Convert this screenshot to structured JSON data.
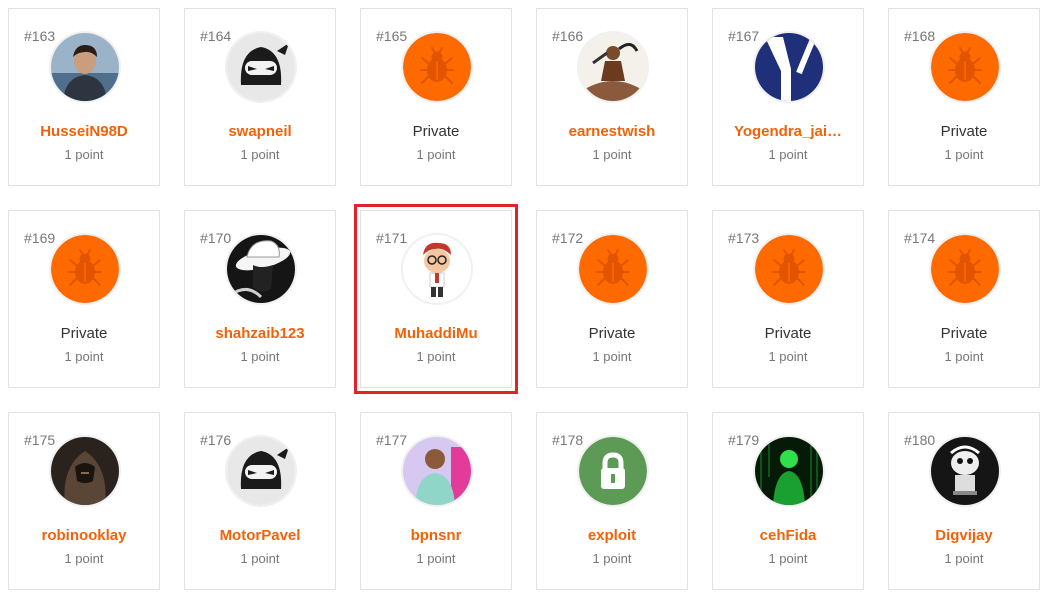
{
  "colors": {
    "accent": "#f0630a",
    "private_avatar": "#ff6a00",
    "highlight": "#e1222a"
  },
  "users": [
    {
      "rank": "#163",
      "name": "HusseiN98D",
      "points": "1 point",
      "avatar": "photo-person-icon",
      "private": false
    },
    {
      "rank": "#164",
      "name": "swapneil",
      "points": "1 point",
      "avatar": "ninja-icon",
      "private": false
    },
    {
      "rank": "#165",
      "name": "Private",
      "points": "1 point",
      "avatar": "bug-icon",
      "private": true
    },
    {
      "rank": "#166",
      "name": "earnestwish",
      "points": "1 point",
      "avatar": "warrior-photo-icon",
      "private": false
    },
    {
      "rank": "#167",
      "name": "Yogendra_jai…",
      "points": "1 point",
      "avatar": "y-logo-icon",
      "private": false
    },
    {
      "rank": "#168",
      "name": "Private",
      "points": "1 point",
      "avatar": "bug-icon",
      "private": true
    },
    {
      "rank": "#169",
      "name": "Private",
      "points": "1 point",
      "avatar": "bug-icon",
      "private": true
    },
    {
      "rank": "#170",
      "name": "shahzaib123",
      "points": "1 point",
      "avatar": "hat-man-icon",
      "private": false
    },
    {
      "rank": "#171",
      "name": "MuhaddiMu",
      "points": "1 point",
      "avatar": "cartoon-boy-icon",
      "private": false,
      "highlight": true
    },
    {
      "rank": "#172",
      "name": "Private",
      "points": "1 point",
      "avatar": "bug-icon",
      "private": true
    },
    {
      "rank": "#173",
      "name": "Private",
      "points": "1 point",
      "avatar": "bug-icon",
      "private": true
    },
    {
      "rank": "#174",
      "name": "Private",
      "points": "1 point",
      "avatar": "bug-icon",
      "private": true
    },
    {
      "rank": "#175",
      "name": "robinooklay",
      "points": "1 point",
      "avatar": "assassin-photo-icon",
      "private": false
    },
    {
      "rank": "#176",
      "name": "MotorPavel",
      "points": "1 point",
      "avatar": "ninja-icon",
      "private": false
    },
    {
      "rank": "#177",
      "name": "bpnsnr",
      "points": "1 point",
      "avatar": "colorful-person-icon",
      "private": false
    },
    {
      "rank": "#178",
      "name": "exploit",
      "points": "1 point",
      "avatar": "lock-icon",
      "private": false
    },
    {
      "rank": "#179",
      "name": "cehFida",
      "points": "1 point",
      "avatar": "matrix-man-icon",
      "private": false
    },
    {
      "rank": "#180",
      "name": "Digvijay",
      "points": "1 point",
      "avatar": "cartoon-mascot-icon",
      "private": false
    }
  ]
}
